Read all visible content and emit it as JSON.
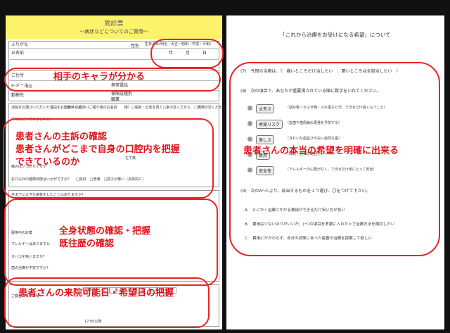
{
  "colors": {
    "accent": "#e0141b",
    "header": "#fdf36b"
  },
  "form": {
    "title": "問診票",
    "subtitle": "～病状などについてのご質問～",
    "furigana": "ふりがな",
    "name": "お名前",
    "sex": "性別",
    "birth_label": "生年月日",
    "eras": "(明治・大正・昭和・平成・令和)",
    "year": "年",
    "month": "月",
    "day": "日",
    "address": "ご住所",
    "phone": "携帯電話",
    "email": "e-メール",
    "work": "勤務先",
    "company": "社名",
    "insurance": "保険証種別",
    "job": "職業",
    "q_reason": "当院をお選びいただいた理由をお聞かせください",
    "q_reason_opts": "□知人の紹介（ご紹介者のお名前　　様）□看板・広告を見て□家の近くだから　□職場の近くだから　□ホームページを見て",
    "q_symptom": "今日はどうされましたか？",
    "q_when": "痛みはいつからですか",
    "q_other": "お口以外の健康状態はいかがですか？",
    "health": "□良好　□普通　□調子が悪い（具体的に）",
    "q_tooth": "左下奥",
    "q_sick": "今までに大きな病気をしたことはありますか？",
    "q_med": "服用中のお薬",
    "q_allergy": "アレルギーはありますか",
    "q_smoke": "タバコを吸いますか？",
    "q_fear": "歯の治療が不安ですか？",
    "days": [
      "月",
      "火",
      "水",
      "木",
      "金",
      "土",
      "日"
    ],
    "time": "17:00以降",
    "visit": "ご都合の良い日時"
  },
  "annotations": {
    "character": "相手のキャラが分かる",
    "complaint1": "患者さんの主訴の確認",
    "complaint2": "患者さんがどこまで自身の口腔内を把握",
    "complaint3": "できているのか",
    "health1": "全身状態の確認・把握",
    "health2": "既往歴の確認",
    "visit": "患者さんの来院可能日・希望日の把握",
    "hope": "患者さんの本当の希望を明確に出来る"
  },
  "hope_form": {
    "title": "「これから治療をお受けになる希望」について",
    "q7": "(7)　今回の治療は、（　痛いところだけ治したい　、悪いところは全部治したい　）",
    "q8": "(8)　次の項目で、あなたが重要視されている順に数字をいれてください。",
    "items": [
      {
        "tag": "丈夫さ",
        "text": "（詰め物・かぶせ物・入れ歯などが、できるだけ長くもつこと）"
      },
      {
        "tag": "再発リスク",
        "text": "（虫歯や歯周病の再発を予防する）"
      },
      {
        "tag": "美しさ",
        "text": "（きれいな歯並びや白い自然な歯）"
      },
      {
        "tag": "費用",
        "text": "（保険・自費の範囲で）"
      },
      {
        "tag": "安全性",
        "text": "（アレルギーの心配がなく、できるだけ体にとって安全）"
      }
    ],
    "q9": "(9)　次のA～Cより、該当するものを１つ選び、〇をつけて下さい。",
    "a": "A.　とにかく治療にかかる費用ができるだけ安い方が良い",
    "b": "B.　費用は少ないほうがいいが、(イ)の項目を考慮に入れた上で治療方法を検討したい",
    "c": "C.　費用にかかわらず、自分の状態にあった最善の治療を提案して欲しい"
  }
}
